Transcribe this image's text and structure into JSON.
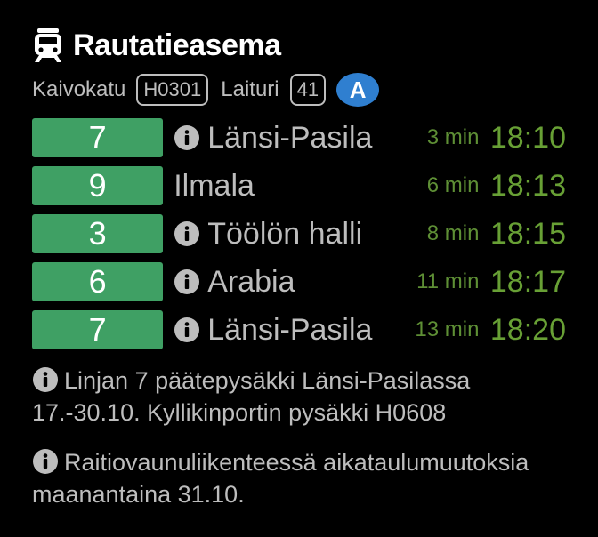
{
  "header": {
    "station_name": "Rautatieasema"
  },
  "subheader": {
    "street": "Kaivokatu",
    "stop_code": "H0301",
    "platform_label": "Laituri",
    "platform_number": "41",
    "zone": "A"
  },
  "departures": [
    {
      "line": "7",
      "destination": "Länsi-Pasila",
      "has_info": true,
      "minutes": "3 min",
      "time": "18:10"
    },
    {
      "line": "9",
      "destination": "Ilmala",
      "has_info": false,
      "minutes": "6 min",
      "time": "18:13"
    },
    {
      "line": "3",
      "destination": "Töölön halli",
      "has_info": true,
      "minutes": "8 min",
      "time": "18:15"
    },
    {
      "line": "6",
      "destination": "Arabia",
      "has_info": true,
      "minutes": "11 min",
      "time": "18:17"
    },
    {
      "line": "7",
      "destination": "Länsi-Pasila",
      "has_info": true,
      "minutes": "13 min",
      "time": "18:20"
    }
  ],
  "notices": [
    {
      "line1": "Linjan 7 päätepysäkki Länsi-Pasilassa",
      "line2": "17.-30.10. Kyllikinportin pysäkki H0608"
    },
    {
      "line1": "Raitiovaunuliikenteessä aikataulumuutoksia",
      "line2": "maanantaina 31.10."
    }
  ],
  "colors": {
    "line_bg": "#3fa064",
    "time": "#68a035",
    "zone_bg": "#2f7fd0",
    "text": "#bdbdbd"
  },
  "icons": {
    "header": "tram-icon",
    "info": "info-icon"
  }
}
